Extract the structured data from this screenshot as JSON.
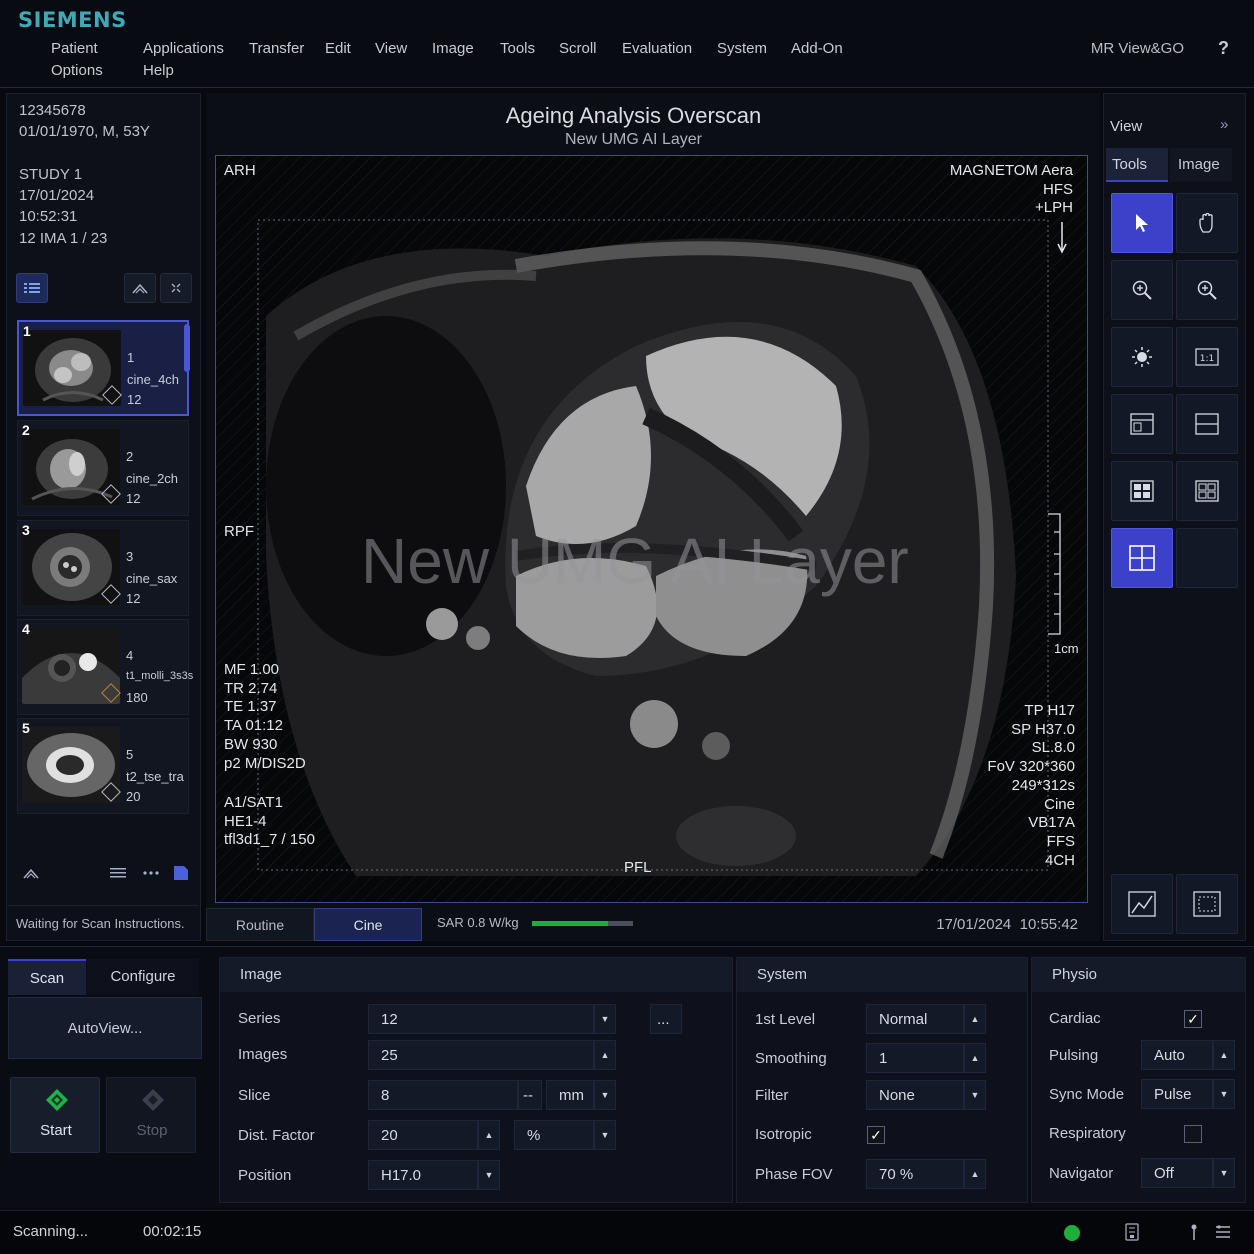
{
  "brand": "SIEMENS",
  "menu": {
    "patient": "Patient",
    "options": "Options",
    "applications": "Applications",
    "help": "Help",
    "transfer": "Transfer",
    "edit": "Edit",
    "view": "View",
    "image": "Image",
    "tools": "Tools",
    "scroll": "Scroll",
    "evaluation": "Evaluation",
    "system": "System",
    "addon": "Add-On"
  },
  "app_title": "MR View&GO",
  "help_icon": "?",
  "patient_info": {
    "id": "12345678",
    "dob_sex_age": "01/01/1970, M, 53Y",
    "study": "STUDY 1",
    "date": "17/01/2024",
    "time": "10:52:31",
    "ima": "12 IMA 1 / 23"
  },
  "series": [
    {
      "index": "1",
      "num": "1",
      "name": "cine_4ch",
      "count": "12"
    },
    {
      "index": "2",
      "num": "2",
      "name": "cine_2ch",
      "count": "12"
    },
    {
      "index": "3",
      "num": "3",
      "name": "cine_sax",
      "count": "12"
    },
    {
      "index": "4",
      "num": "4",
      "name": "t1_molli_3s3s",
      "count": "180"
    },
    {
      "index": "5",
      "num": "5",
      "name": "t2_tse_tra",
      "count": "20"
    }
  ],
  "left_status": "Waiting for Scan Instructions.",
  "viewer": {
    "title": "Ageing Analysis Overscan",
    "subtitle": "New UMG AI Layer",
    "watermark": "New UMG AI Layer",
    "orient_top": "ARH",
    "orient_left": "RPF",
    "orient_bottom": "PFL",
    "top_right": [
      "MAGNETOM Aera",
      "HFS",
      "+LPH"
    ],
    "scale_label": "1cm",
    "left_params": [
      "MF 1.00",
      "TR 2.74",
      "TE 1.37",
      "TA 01:12",
      "BW 930",
      "p2 M/DIS2D"
    ],
    "left_params2": [
      "A1/SAT1",
      "HE1-4",
      "tfl3d1_7 / 150"
    ],
    "right_params": [
      "TP H17",
      "SP H37.0",
      "SL.8.0",
      "FoV 320*360",
      "249*312s",
      "Cine",
      "VB17A",
      "FFS",
      "4CH"
    ],
    "tab_routine": "Routine",
    "tab_cine": "Cine",
    "sar": "SAR 0.8 W/kg",
    "sar_level": 0.75,
    "datetime": "17/01/2024  10:55:42"
  },
  "right_panel": {
    "view": "View",
    "expand": "»",
    "tab_tools": "Tools",
    "tab_image": "Image"
  },
  "scan": {
    "tab_scan": "Scan",
    "tab_configure": "Configure",
    "autoview": "AutoView...",
    "start": "Start",
    "stop": "Stop"
  },
  "image_section": {
    "header": "Image",
    "series_label": "Series",
    "series_value": "12",
    "images_label": "Images",
    "images_value": "25",
    "slice_label": "Slice",
    "slice_value": "8",
    "slice_dash": "--",
    "slice_unit": "mm",
    "dist_label": "Dist. Factor",
    "dist_value": "20",
    "dist_unit": "%",
    "position_label": "Position",
    "position_value": "H17.0",
    "more": "..."
  },
  "system_section": {
    "header": "System",
    "level_label": "1st Level",
    "level_value": "Normal",
    "smoothing_label": "Smoothing",
    "smoothing_value": "1",
    "filter_label": "Filter",
    "filter_value": "None",
    "isotropic_label": "Isotropic",
    "isotropic_checked": true,
    "phasefov_label": "Phase FOV",
    "phasefov_value": "70 %"
  },
  "physio_section": {
    "header": "Physio",
    "cardiac_label": "Cardiac",
    "cardiac_checked": true,
    "pulsing_label": "Pulsing",
    "pulsing_value": "Auto",
    "sync_label": "Sync Mode",
    "sync_value": "Pulse",
    "resp_label": "Respiratory",
    "resp_checked": false,
    "nav_label": "Navigator",
    "nav_value": "Off"
  },
  "statusbar": {
    "state": "Scanning...",
    "elapsed": "00:02:15",
    "indicator_color": "#1fae3a"
  },
  "colors": {
    "accent": "#3b41c9",
    "brand": "#3fa9b5",
    "sar_bar": "#1fae3a"
  }
}
